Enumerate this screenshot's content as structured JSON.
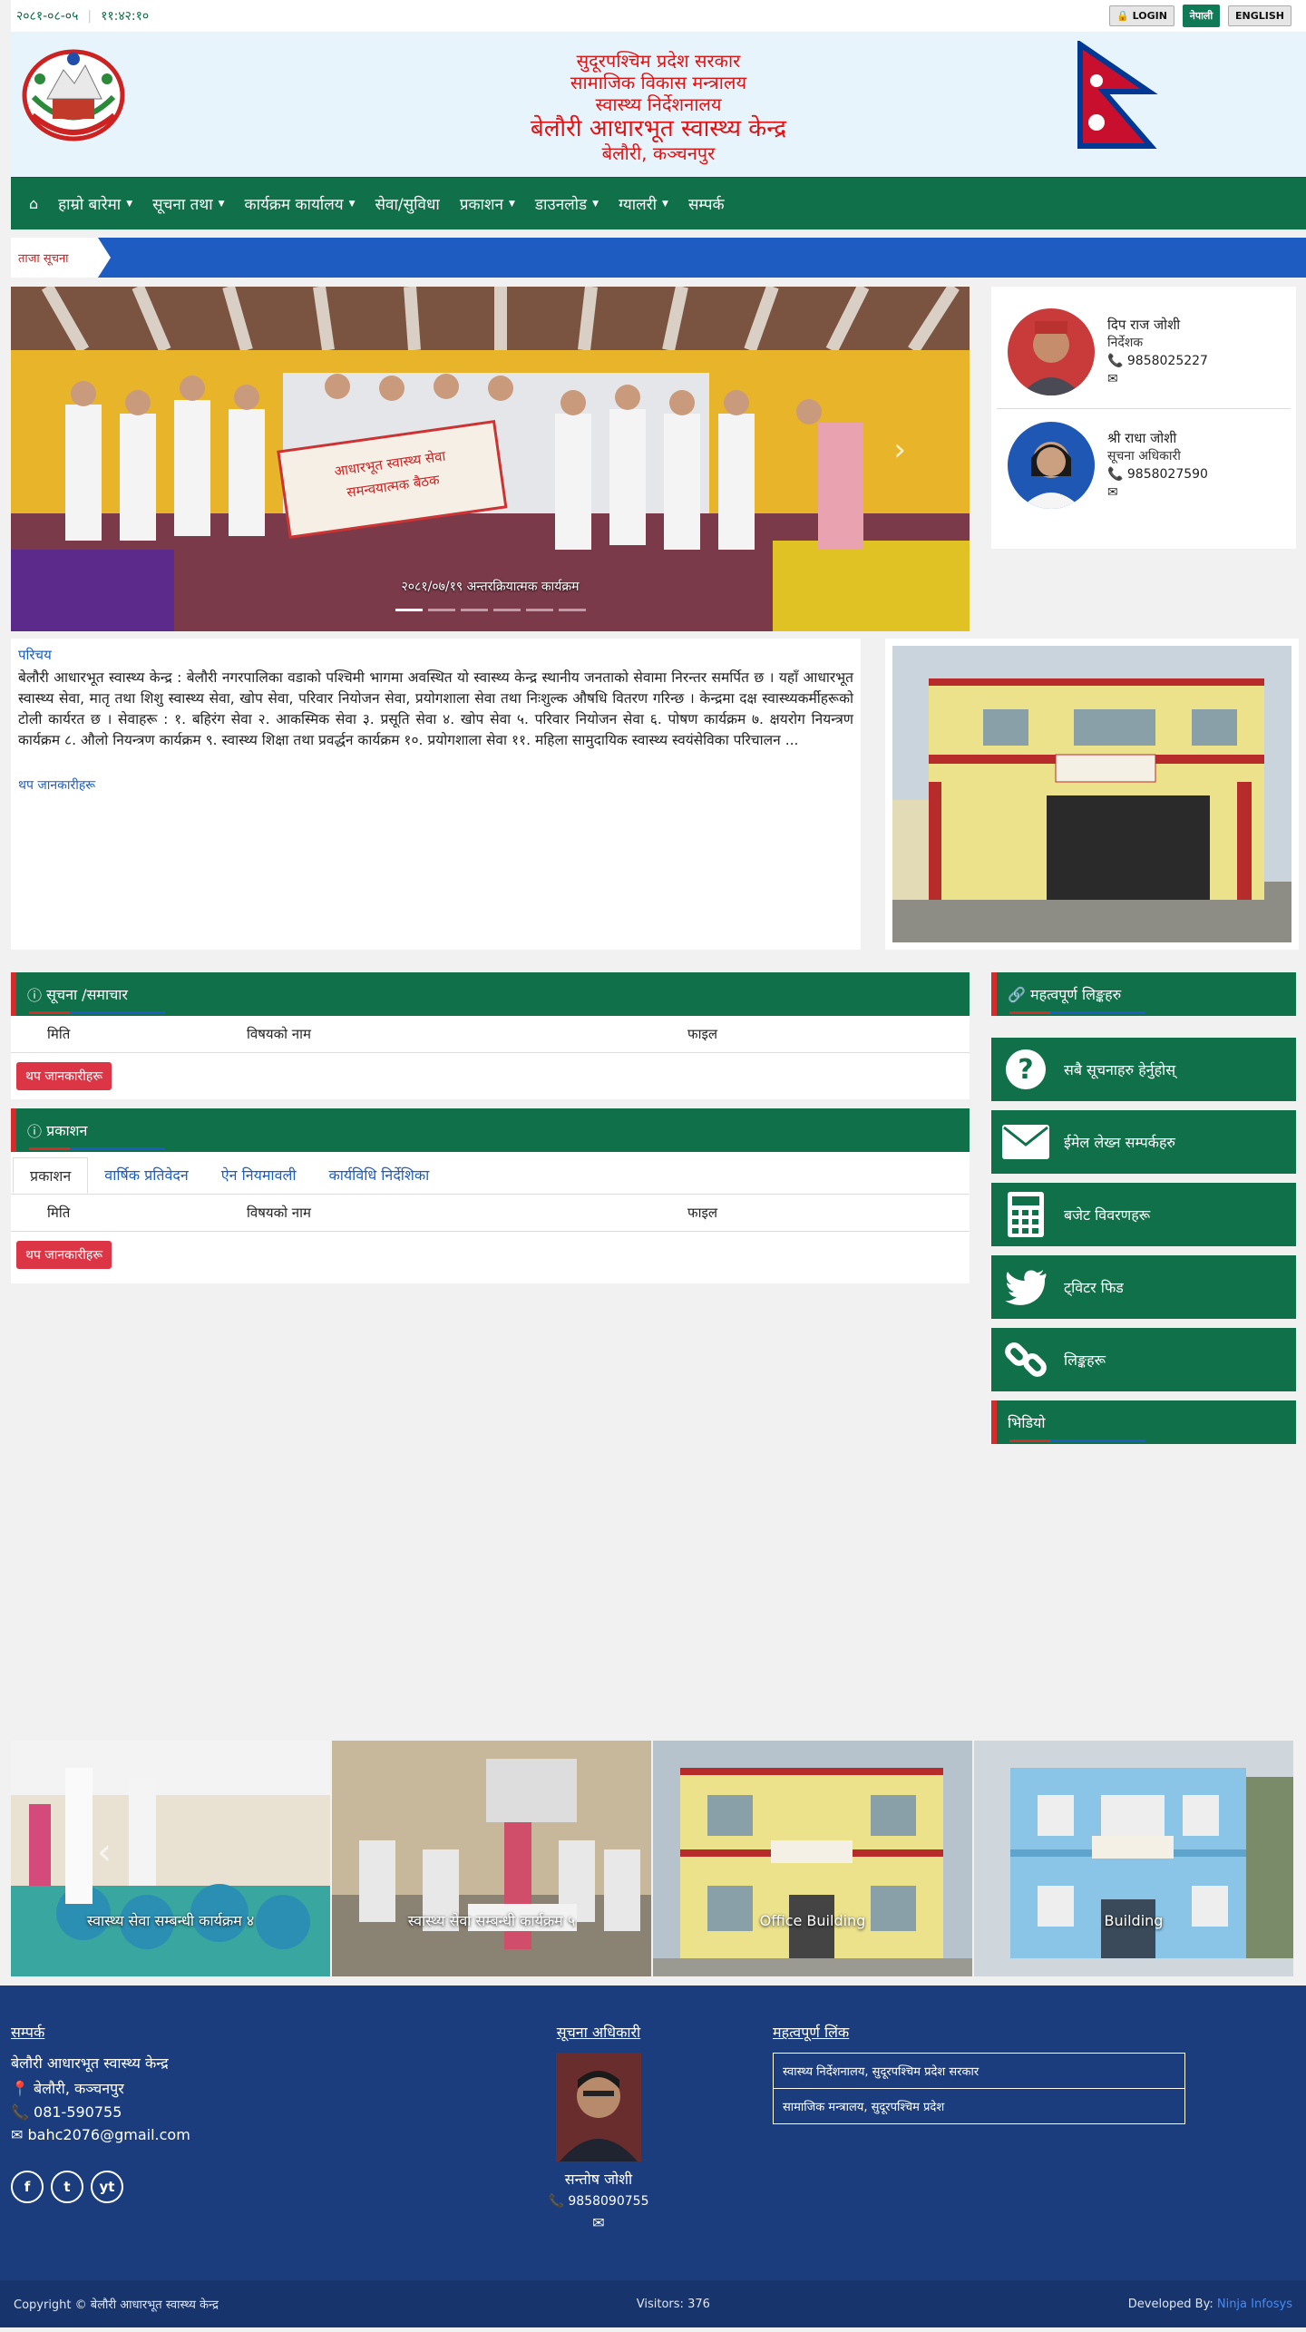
{
  "topbar": {
    "date": "२०८१-०८-०५",
    "time": "११:४२:१०",
    "login": "🔒 LOGIN",
    "lang_np": "नेपाली",
    "lang_en": "ENGLISH"
  },
  "header": {
    "line1": "सुदूरपश्चिम प्रदेश सरकार",
    "line2": "सामाजिक विकास मन्त्रालय",
    "line3": "स्वास्थ्य निर्देशनालय",
    "line4": "बेलौरी आधारभूत स्वास्थ्य केन्द्र",
    "line5": "बेलौरी, कञ्चनपुर"
  },
  "nav": {
    "items": [
      "हाम्रो बारेमा",
      "सूचना तथा",
      "कार्यक्रम कार्यालय",
      "सेवा/सुविधा",
      "प्रकाशन",
      "डाउनलोड",
      "ग्यालरी",
      "सम्पर्क"
    ]
  },
  "ticker": {
    "label": "ताजा सूचना"
  },
  "slider": {
    "caption": "२०८१/०७/१९ अन्तरक्रियात्मक कार्यक्रम",
    "banner_line1": "आधारभूत स्वास्थ्य सेवा",
    "banner_line2": "समन्वयात्मक बैठक"
  },
  "officials": [
    {
      "name": "दिप राज जोशी",
      "title": "निर्देशक",
      "phone": "📞 9858025227",
      "email": "✉"
    },
    {
      "name": "श्री राधा जोशी",
      "title": "सूचना अधिकारी",
      "phone": "📞 9858027590",
      "email": "✉"
    }
  ],
  "about": {
    "heading": "परिचय",
    "body": "बेलौरी आधारभूत स्वास्थ्य केन्द्र : बेलौरी नगरपालिका वडाको पश्चिमी भागमा अवस्थित यो स्वास्थ्य केन्द्र स्थानीय जनताको सेवामा निरन्तर समर्पित छ । यहाँ आधारभूत स्वास्थ्य सेवा, मातृ तथा शिशु स्वास्थ्य सेवा, खोप सेवा, परिवार नियोजन सेवा, प्रयोगशाला सेवा तथा निःशुल्क औषधि वितरण गरिन्छ । केन्द्रमा दक्ष स्वास्थ्यकर्मीहरूको टोली कार्यरत छ । सेवाहरू : १. बहिरंग सेवा २. आकस्मिक सेवा ३. प्रसूति सेवा ४. खोप सेवा ५. परिवार नियोजन सेवा ६. पोषण कार्यक्रम ७. क्षयरोग नियन्त्रण कार्यक्रम ८. औलो नियन्त्रण कार्यक्रम ९. स्वास्थ्य शिक्षा तथा प्रवर्द्धन कार्यक्रम १०. प्रयोगशाला सेवा ११. महिला सामुदायिक स्वास्थ्य स्वयंसेविका परिचालन ... ",
    "more": "थप जानकारीहरू"
  },
  "notices": {
    "heading": "सूचना /समाचार",
    "col1": "मिति",
    "col2": "विषयको नाम",
    "col3": "फाइल",
    "btn": "थप जानकारीहरू"
  },
  "downloads": {
    "heading": "प्रकाशन",
    "tabs": [
      "प्रकाशन",
      "वार्षिक प्रतिवेदन",
      "ऐन नियमावली",
      "कार्यविधि निर्देशिका"
    ],
    "col1": "मिति",
    "col2": "विषयको नाम",
    "col3": "फाइल",
    "btn": "थप जानकारीहरू"
  },
  "quick": {
    "heading": "महत्वपूर्ण लिङ्कहरु",
    "links": [
      {
        "label": "सबै सूचनाहरु हेर्नुहोस्",
        "icon": "question-icon"
      },
      {
        "label": "ईमेल लेख्न सम्पर्कहरु",
        "icon": "mail-icon"
      },
      {
        "label": "बजेट विवरणहरू",
        "icon": "calculator-icon"
      },
      {
        "label": "ट्विटर फिड",
        "icon": "twitter-icon"
      },
      {
        "label": "लिङ्कहरू",
        "icon": "link-icon"
      }
    ],
    "video": "भिडियो"
  },
  "gallery": [
    {
      "caption": "स्वास्थ्य सेवा सम्बन्धी कार्यक्रम ४"
    },
    {
      "caption": "स्वास्थ्य सेवा सम्बन्धी कार्यक्रम ५"
    },
    {
      "caption": "Office Building"
    },
    {
      "caption": "Building"
    }
  ],
  "footer": {
    "contact_heading": "सम्पर्क",
    "org": "बेलौरी आधारभूत स्वास्थ्य केन्द्र",
    "address": "📍 बेलौरी, कञ्चनपुर",
    "phone": "📞 081-590755",
    "email": "✉ bahc2076@gmail.com",
    "info_heading": "सूचना अधिकारी",
    "info_name": "सन्तोष जोशी",
    "info_phone": "📞 9858090755",
    "info_email": "✉",
    "links_heading": "महत्वपूर्ण लिंक",
    "links": [
      "स्वास्थ्य निर्देशनालय, सुदूरपश्चिम प्रदेश सरकार",
      "सामाजिक मन्त्रालय, सुदूरपश्चिम प्रदेश"
    ],
    "social": [
      "f",
      "t",
      "yt"
    ]
  },
  "bottom": {
    "copyright": "Copyright © बेलौरी आधारभूत स्वास्थ्य केन्द्र",
    "visitors": "Visitors: 376",
    "dev_label": "Developed By:",
    "dev_name": "Ninja Infosys"
  },
  "colors": {
    "primary": "#0f7049",
    "accent": "#d52b2b",
    "blue": "#1e5cc1",
    "footer": "#1b3d7d"
  }
}
